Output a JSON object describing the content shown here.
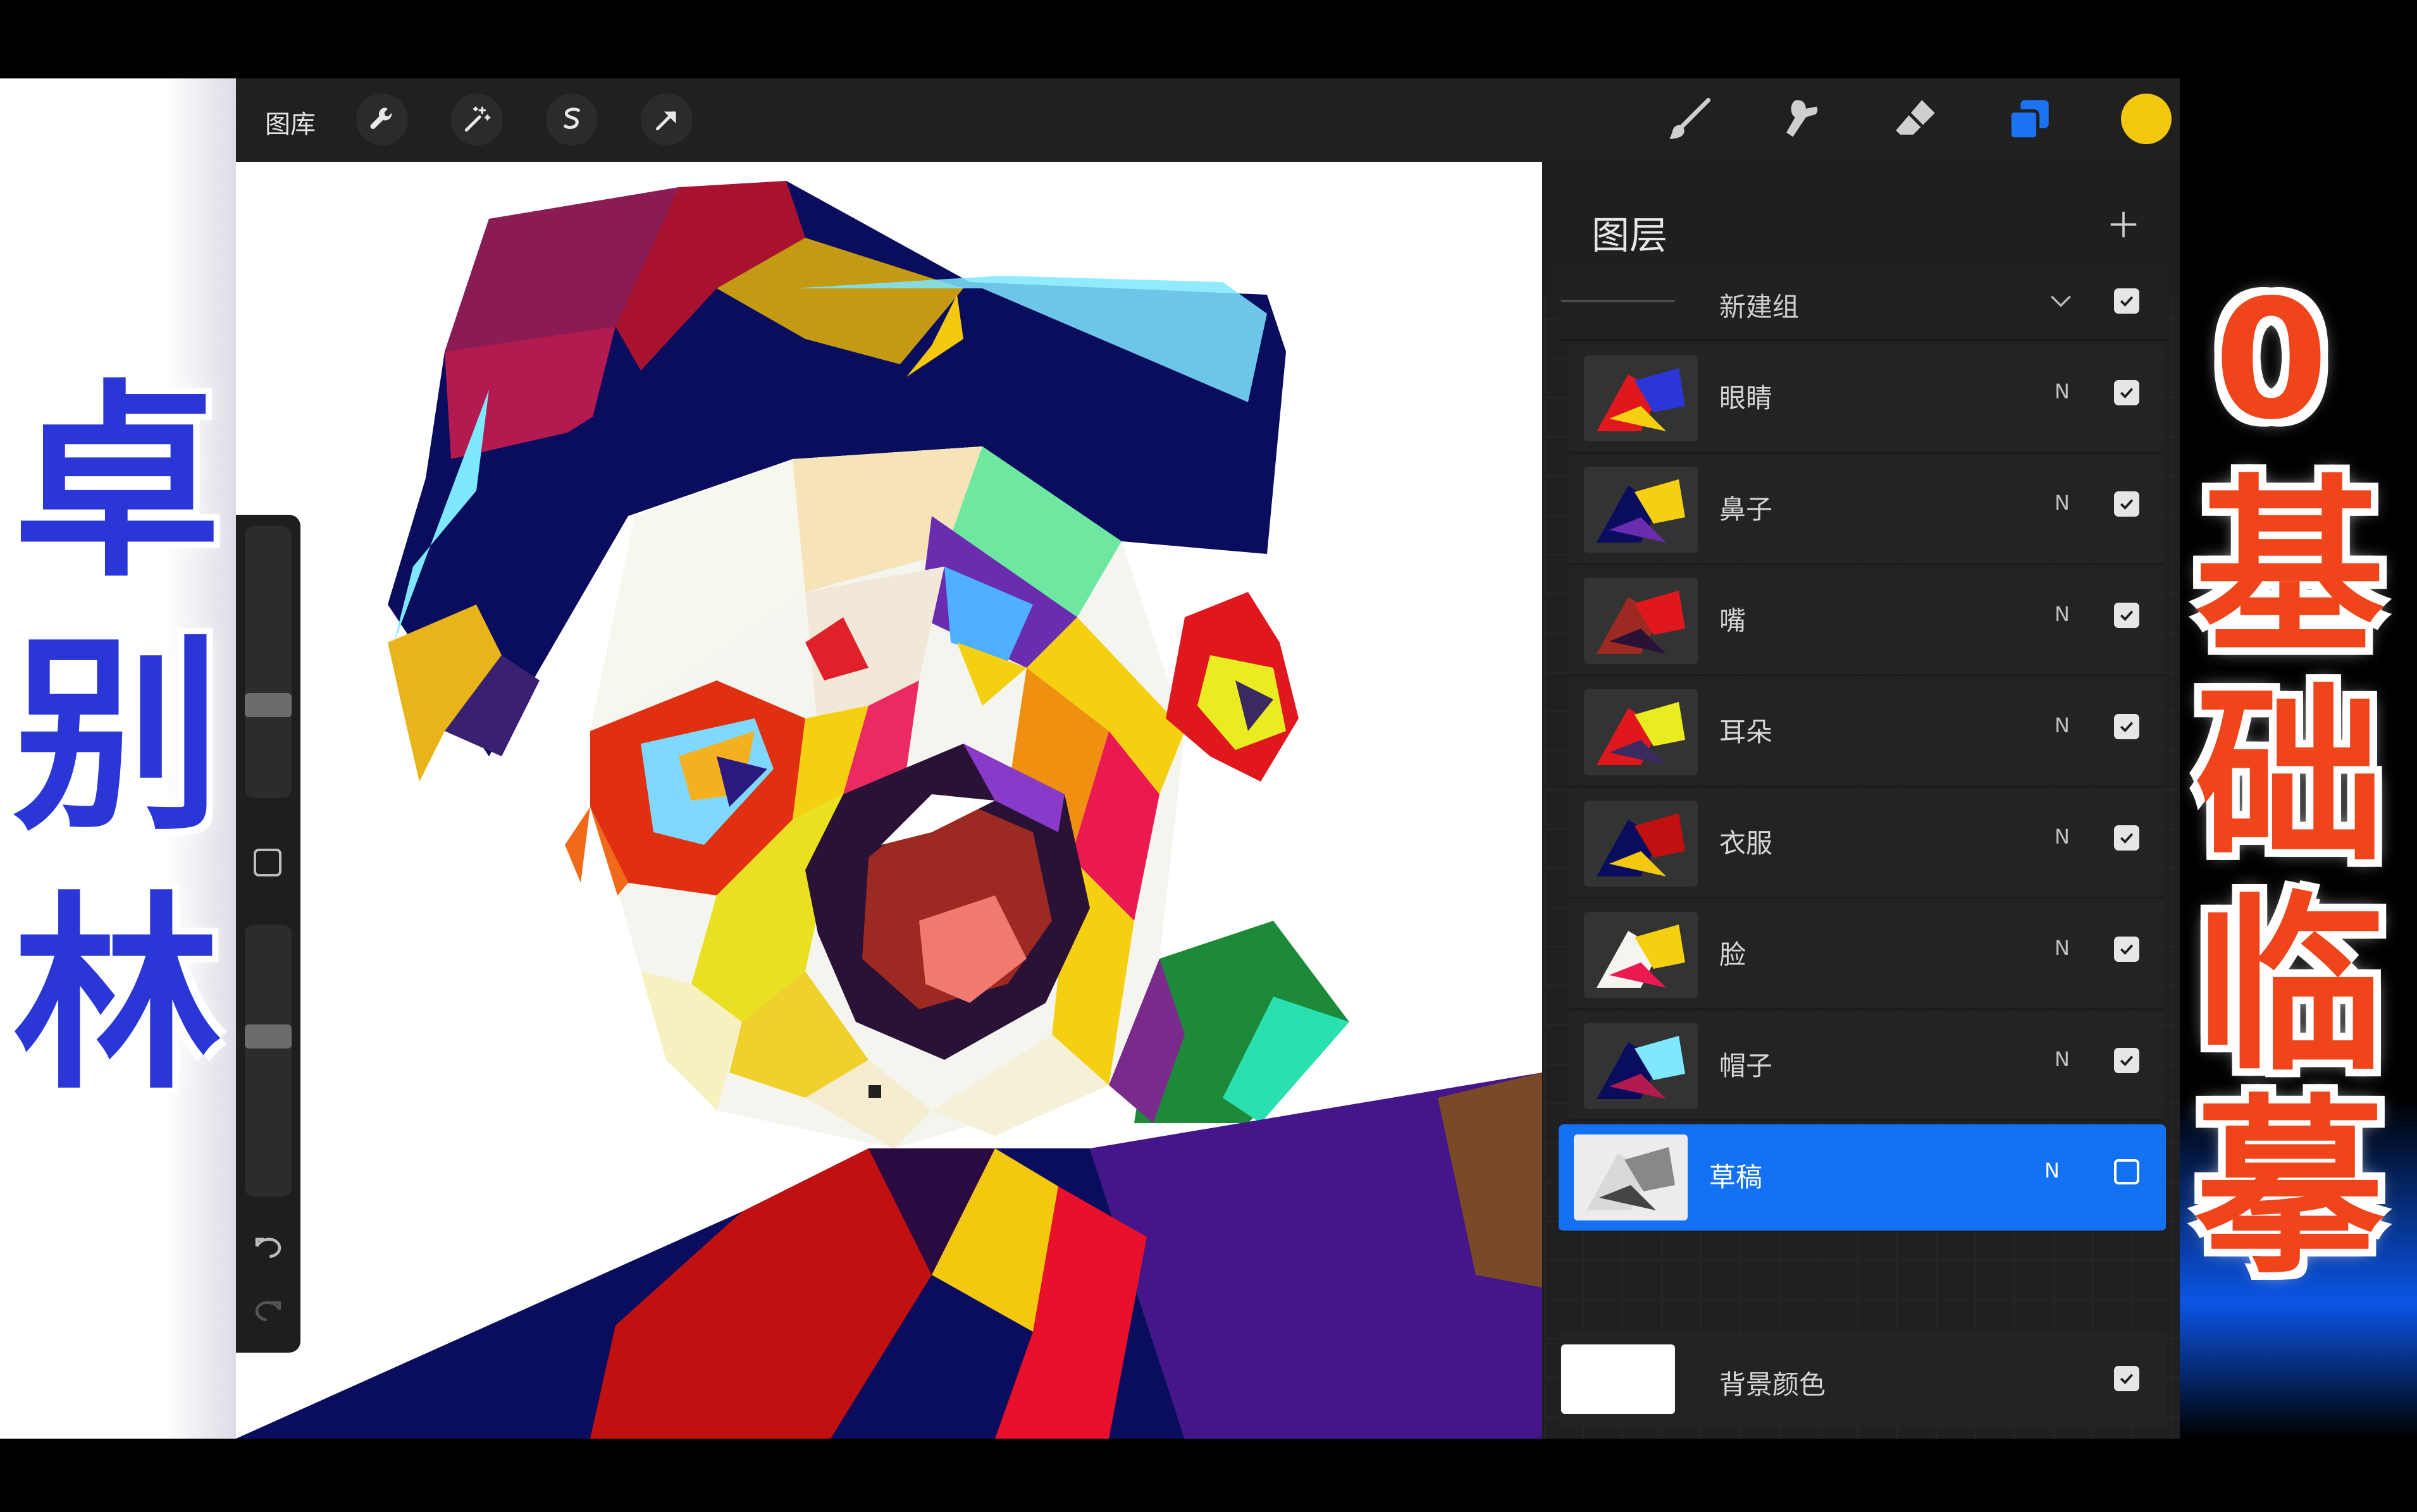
{
  "topbar": {
    "gallery_label": "图库",
    "left_tools": [
      "wrench-icon",
      "magic-wand-icon",
      "selection-icon",
      "transform-arrow-icon"
    ],
    "right_tools": [
      "brush-icon",
      "smudge-icon",
      "eraser-icon",
      "layers-icon"
    ],
    "accent": "#1b73f3",
    "current_color": "#f2c80f"
  },
  "layers_panel": {
    "title": "图层",
    "add_icon": "plus-icon",
    "group": {
      "label": "新建组",
      "expand_icon": "chevron-down-icon",
      "visible": true
    },
    "layers": [
      {
        "name": "眼睛",
        "mode": "N",
        "visible": true,
        "active": false
      },
      {
        "name": "鼻子",
        "mode": "N",
        "visible": true,
        "active": false
      },
      {
        "name": "嘴",
        "mode": "N",
        "visible": true,
        "active": false
      },
      {
        "name": "耳朵",
        "mode": "N",
        "visible": true,
        "active": false
      },
      {
        "name": "衣服",
        "mode": "N",
        "visible": true,
        "active": false
      },
      {
        "name": "脸",
        "mode": "N",
        "visible": true,
        "active": false
      },
      {
        "name": "帽子",
        "mode": "N",
        "visible": true,
        "active": false
      },
      {
        "name": "草稿",
        "mode": "N",
        "visible": false,
        "active": true
      }
    ],
    "background_layer": {
      "name": "背景颜色",
      "visible": true
    }
  },
  "sidebar": {
    "tools": [
      "brush-size-slider",
      "modify-button",
      "opacity-slider",
      "undo-icon",
      "redo-icon"
    ]
  },
  "overlay": {
    "left_title": [
      "卓",
      "别",
      "林"
    ],
    "right_title": [
      "0",
      "基",
      "础",
      "临",
      "摹"
    ]
  }
}
